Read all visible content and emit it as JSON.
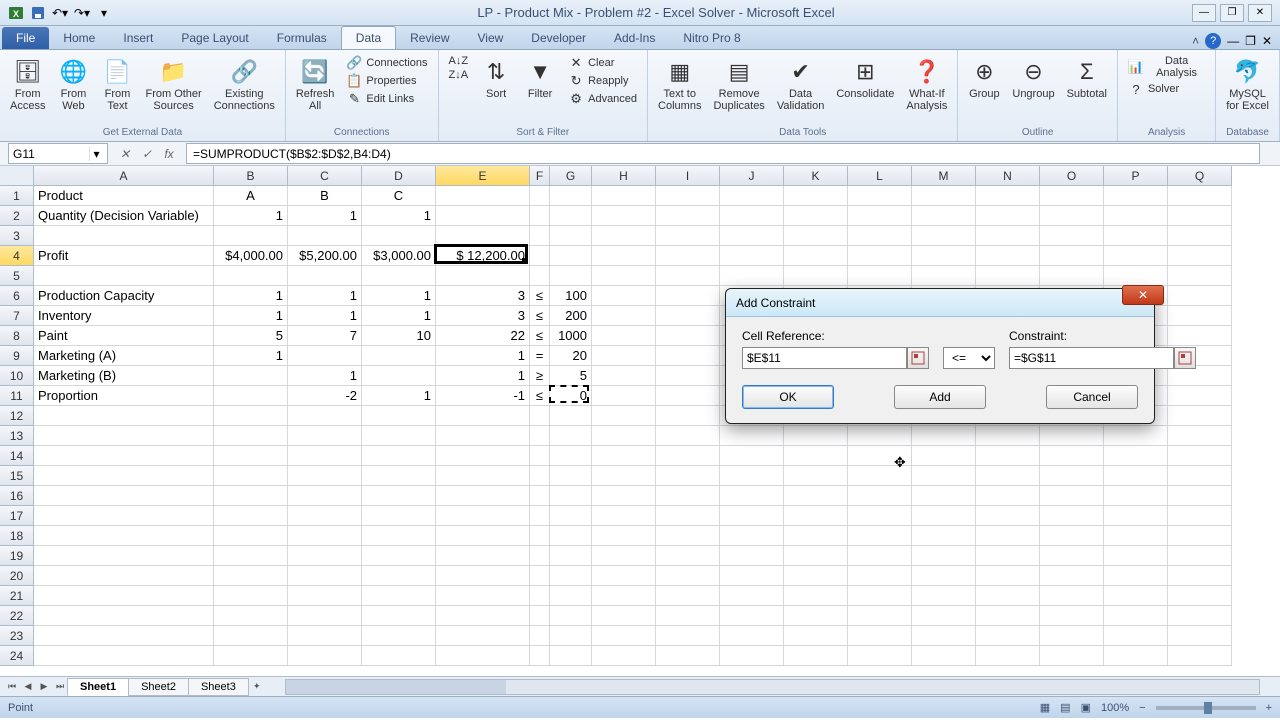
{
  "app": {
    "title": "LP - Product Mix - Problem #2 - Excel Solver - Microsoft Excel"
  },
  "tabs": {
    "file": "File",
    "items": [
      "Home",
      "Insert",
      "Page Layout",
      "Formulas",
      "Data",
      "Review",
      "View",
      "Developer",
      "Add-Ins",
      "Nitro Pro 8"
    ],
    "active": "Data"
  },
  "ribbon": {
    "groups": {
      "external": {
        "title": "Get External Data",
        "from_access": "From\nAccess",
        "from_web": "From\nWeb",
        "from_text": "From\nText",
        "from_other": "From Other\nSources",
        "existing": "Existing\nConnections"
      },
      "connections": {
        "title": "Connections",
        "refresh": "Refresh\nAll",
        "connections": "Connections",
        "properties": "Properties",
        "edit_links": "Edit Links"
      },
      "sortfilter": {
        "title": "Sort & Filter",
        "sort": "Sort",
        "filter": "Filter",
        "clear": "Clear",
        "reapply": "Reapply",
        "advanced": "Advanced"
      },
      "datatools": {
        "title": "Data Tools",
        "text_to_cols": "Text to\nColumns",
        "remove_dup": "Remove\nDuplicates",
        "validation": "Data\nValidation",
        "consolidate": "Consolidate",
        "whatif": "What-If\nAnalysis"
      },
      "outline": {
        "title": "Outline",
        "group": "Group",
        "ungroup": "Ungroup",
        "subtotal": "Subtotal"
      },
      "analysis": {
        "title": "Analysis",
        "data_analysis": "Data Analysis",
        "solver": "Solver"
      },
      "mysql": {
        "title": "Database",
        "mysql": "MySQL\nfor Excel"
      }
    }
  },
  "formula_bar": {
    "name_box": "G11",
    "formula": "=SUMPRODUCT($B$2:$D$2,B4:D4)"
  },
  "columns": [
    "A",
    "B",
    "C",
    "D",
    "E",
    "F",
    "G",
    "H",
    "I",
    "J",
    "K",
    "L",
    "M",
    "N",
    "O",
    "P",
    "Q"
  ],
  "col_widths": {
    "A": 180,
    "B": 74,
    "C": 74,
    "D": 74,
    "E": 94,
    "F": 20,
    "G": 42,
    "default": 64
  },
  "rows": [
    {
      "n": 1,
      "A": "Product",
      "B": "A",
      "C": "B",
      "D": "C"
    },
    {
      "n": 2,
      "A": "Quantity (Decision Variable)",
      "B": "1",
      "C": "1",
      "D": "1"
    },
    {
      "n": 3
    },
    {
      "n": 4,
      "A": "Profit",
      "B": "$4,000.00",
      "C": "$5,200.00",
      "D": "$3,000.00",
      "E": "$   12,200.00"
    },
    {
      "n": 5
    },
    {
      "n": 6,
      "A": "Production Capacity",
      "B": "1",
      "C": "1",
      "D": "1",
      "E": "3",
      "F": "≤",
      "G": "100"
    },
    {
      "n": 7,
      "A": "Inventory",
      "B": "1",
      "C": "1",
      "D": "1",
      "E": "3",
      "F": "≤",
      "G": "200"
    },
    {
      "n": 8,
      "A": "Paint",
      "B": "5",
      "C": "7",
      "D": "10",
      "E": "22",
      "F": "≤",
      "G": "1000"
    },
    {
      "n": 9,
      "A": "Marketing (A)",
      "B": "1",
      "E": "1",
      "F": "=",
      "G": "20"
    },
    {
      "n": 10,
      "A": "Marketing (B)",
      "C": "1",
      "E": "1",
      "F": "≥",
      "G": "5"
    },
    {
      "n": 11,
      "A": "Proportion",
      "C": "-2",
      "D": "1",
      "E": "-1",
      "F": "≤",
      "G": "0"
    },
    {
      "n": 12
    },
    {
      "n": 13
    },
    {
      "n": 14
    },
    {
      "n": 15
    },
    {
      "n": 16
    },
    {
      "n": 17
    },
    {
      "n": 18
    },
    {
      "n": 19
    },
    {
      "n": 20
    },
    {
      "n": 21
    },
    {
      "n": 22
    },
    {
      "n": 23
    },
    {
      "n": 24
    }
  ],
  "sheets": {
    "items": [
      "Sheet1",
      "Sheet2",
      "Sheet3"
    ],
    "active": "Sheet1"
  },
  "status": {
    "mode": "Point",
    "zoom": "100%"
  },
  "dialog": {
    "title": "Add Constraint",
    "cell_ref_label": "Cell Reference:",
    "cell_ref_value": "$E$11",
    "operator": "<=",
    "constraint_label": "Constraint:",
    "constraint_value": "=$G$11",
    "ok": "OK",
    "add": "Add",
    "cancel": "Cancel"
  }
}
